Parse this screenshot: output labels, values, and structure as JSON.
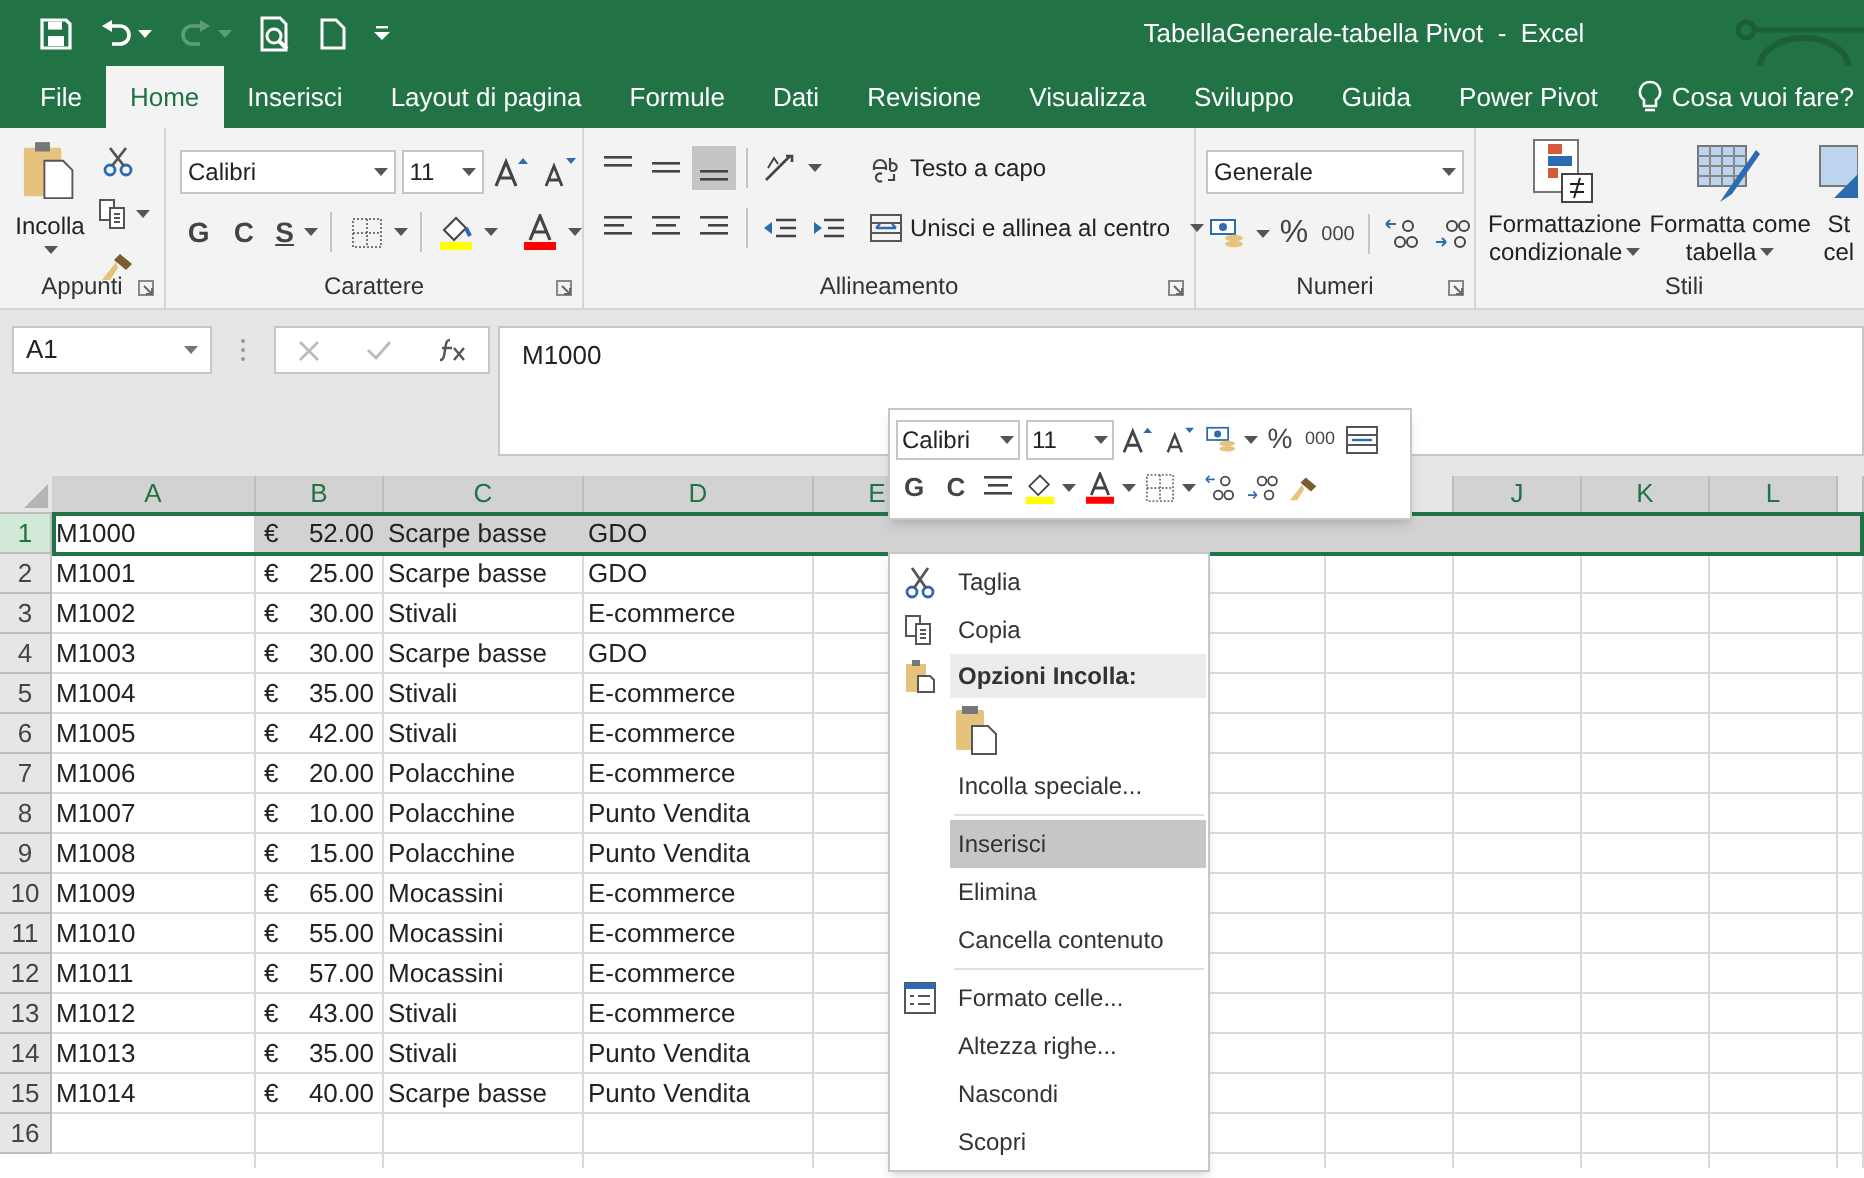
{
  "window": {
    "title": "TabellaGenerale-tabella Pivot  -  Excel"
  },
  "tabs": [
    {
      "label": "File",
      "selected": false
    },
    {
      "label": "Home",
      "selected": true
    },
    {
      "label": "Inserisci",
      "selected": false
    },
    {
      "label": "Layout di pagina",
      "selected": false
    },
    {
      "label": "Formule",
      "selected": false
    },
    {
      "label": "Dati",
      "selected": false
    },
    {
      "label": "Revisione",
      "selected": false
    },
    {
      "label": "Visualizza",
      "selected": false
    },
    {
      "label": "Sviluppo",
      "selected": false
    },
    {
      "label": "Guida",
      "selected": false
    },
    {
      "label": "Power Pivot",
      "selected": false
    }
  ],
  "tell_me": "Cosa vuoi fare?",
  "ribbon": {
    "clipboard": {
      "paste": "Incolla",
      "label": "Appunti"
    },
    "font": {
      "font": "Calibri",
      "size": "11",
      "bold": "G",
      "italic": "C",
      "underline": "S",
      "label": "Carattere"
    },
    "alignment": {
      "wrap": "Testo a capo",
      "merge": "Unisci e allinea al centro",
      "label": "Allineamento"
    },
    "number": {
      "format": "Generale",
      "percent": "%",
      "thousands": "000",
      "label": "Numeri"
    },
    "styles": {
      "conditional": [
        "Formattazione",
        "condizionale"
      ],
      "as_table": [
        "Formatta come",
        "tabella"
      ],
      "cell_styles": [
        "St",
        "cel"
      ],
      "label": "Stili"
    }
  },
  "formula_bar": {
    "name_box": "A1",
    "value": "M1000"
  },
  "columns": [
    "A",
    "B",
    "C",
    "D",
    "E",
    "J",
    "K",
    "L"
  ],
  "rows": [
    {
      "number": "1",
      "selected": true,
      "cells": [
        "M1000",
        "€",
        "52.00",
        "Scarpe basse",
        "GDO"
      ]
    },
    {
      "number": "2",
      "selected": false,
      "cells": [
        "M1001",
        "€",
        "25.00",
        "Scarpe basse",
        "GDO"
      ]
    },
    {
      "number": "3",
      "selected": false,
      "cells": [
        "M1002",
        "€",
        "30.00",
        "Stivali",
        "E-commerce"
      ]
    },
    {
      "number": "4",
      "selected": false,
      "cells": [
        "M1003",
        "€",
        "30.00",
        "Scarpe basse",
        "GDO"
      ]
    },
    {
      "number": "5",
      "selected": false,
      "cells": [
        "M1004",
        "€",
        "35.00",
        "Stivali",
        "E-commerce"
      ]
    },
    {
      "number": "6",
      "selected": false,
      "cells": [
        "M1005",
        "€",
        "42.00",
        "Stivali",
        "E-commerce"
      ]
    },
    {
      "number": "7",
      "selected": false,
      "cells": [
        "M1006",
        "€",
        "20.00",
        "Polacchine",
        "E-commerce"
      ]
    },
    {
      "number": "8",
      "selected": false,
      "cells": [
        "M1007",
        "€",
        "10.00",
        "Polacchine",
        "Punto Vendita"
      ]
    },
    {
      "number": "9",
      "selected": false,
      "cells": [
        "M1008",
        "€",
        "15.00",
        "Polacchine",
        "Punto Vendita"
      ]
    },
    {
      "number": "10",
      "selected": false,
      "cells": [
        "M1009",
        "€",
        "65.00",
        "Mocassini",
        "E-commerce"
      ]
    },
    {
      "number": "11",
      "selected": false,
      "cells": [
        "M1010",
        "€",
        "55.00",
        "Mocassini",
        "E-commerce"
      ]
    },
    {
      "number": "12",
      "selected": false,
      "cells": [
        "M1011",
        "€",
        "57.00",
        "Mocassini",
        "E-commerce"
      ]
    },
    {
      "number": "13",
      "selected": false,
      "cells": [
        "M1012",
        "€",
        "43.00",
        "Stivali",
        "E-commerce"
      ]
    },
    {
      "number": "14",
      "selected": false,
      "cells": [
        "M1013",
        "€",
        "35.00",
        "Stivali",
        "Punto Vendita"
      ]
    },
    {
      "number": "15",
      "selected": false,
      "cells": [
        "M1014",
        "€",
        "40.00",
        "Scarpe basse",
        "Punto Vendita"
      ]
    },
    {
      "number": "16",
      "selected": false,
      "cells": []
    }
  ],
  "mini_toolbar": {
    "font": "Calibri",
    "size": "11",
    "percent": "%",
    "thousands": "000",
    "bold": "G",
    "italic": "C"
  },
  "context_menu": [
    {
      "kind": "cut",
      "label": "Taglia",
      "selected": false
    },
    {
      "kind": "copy",
      "label": "Copia",
      "selected": false
    },
    {
      "kind": "header",
      "label": "Opzioni Incolla:",
      "selected": false
    },
    {
      "kind": "paste_options",
      "selected": false
    },
    {
      "kind": "item",
      "label": "Incolla speciale...",
      "selected": false
    },
    {
      "kind": "separator"
    },
    {
      "kind": "item",
      "label": "Inserisci",
      "selected": true
    },
    {
      "kind": "item",
      "label": "Elimina",
      "selected": false
    },
    {
      "kind": "item",
      "label": "Cancella contenuto",
      "selected": false
    },
    {
      "kind": "separator"
    },
    {
      "kind": "format",
      "label": "Formato celle...",
      "selected": false
    },
    {
      "kind": "item",
      "label": "Altezza righe...",
      "selected": false
    },
    {
      "kind": "item",
      "label": "Nascondi",
      "selected": false
    },
    {
      "kind": "item",
      "label": "Scopri",
      "selected": false
    }
  ]
}
